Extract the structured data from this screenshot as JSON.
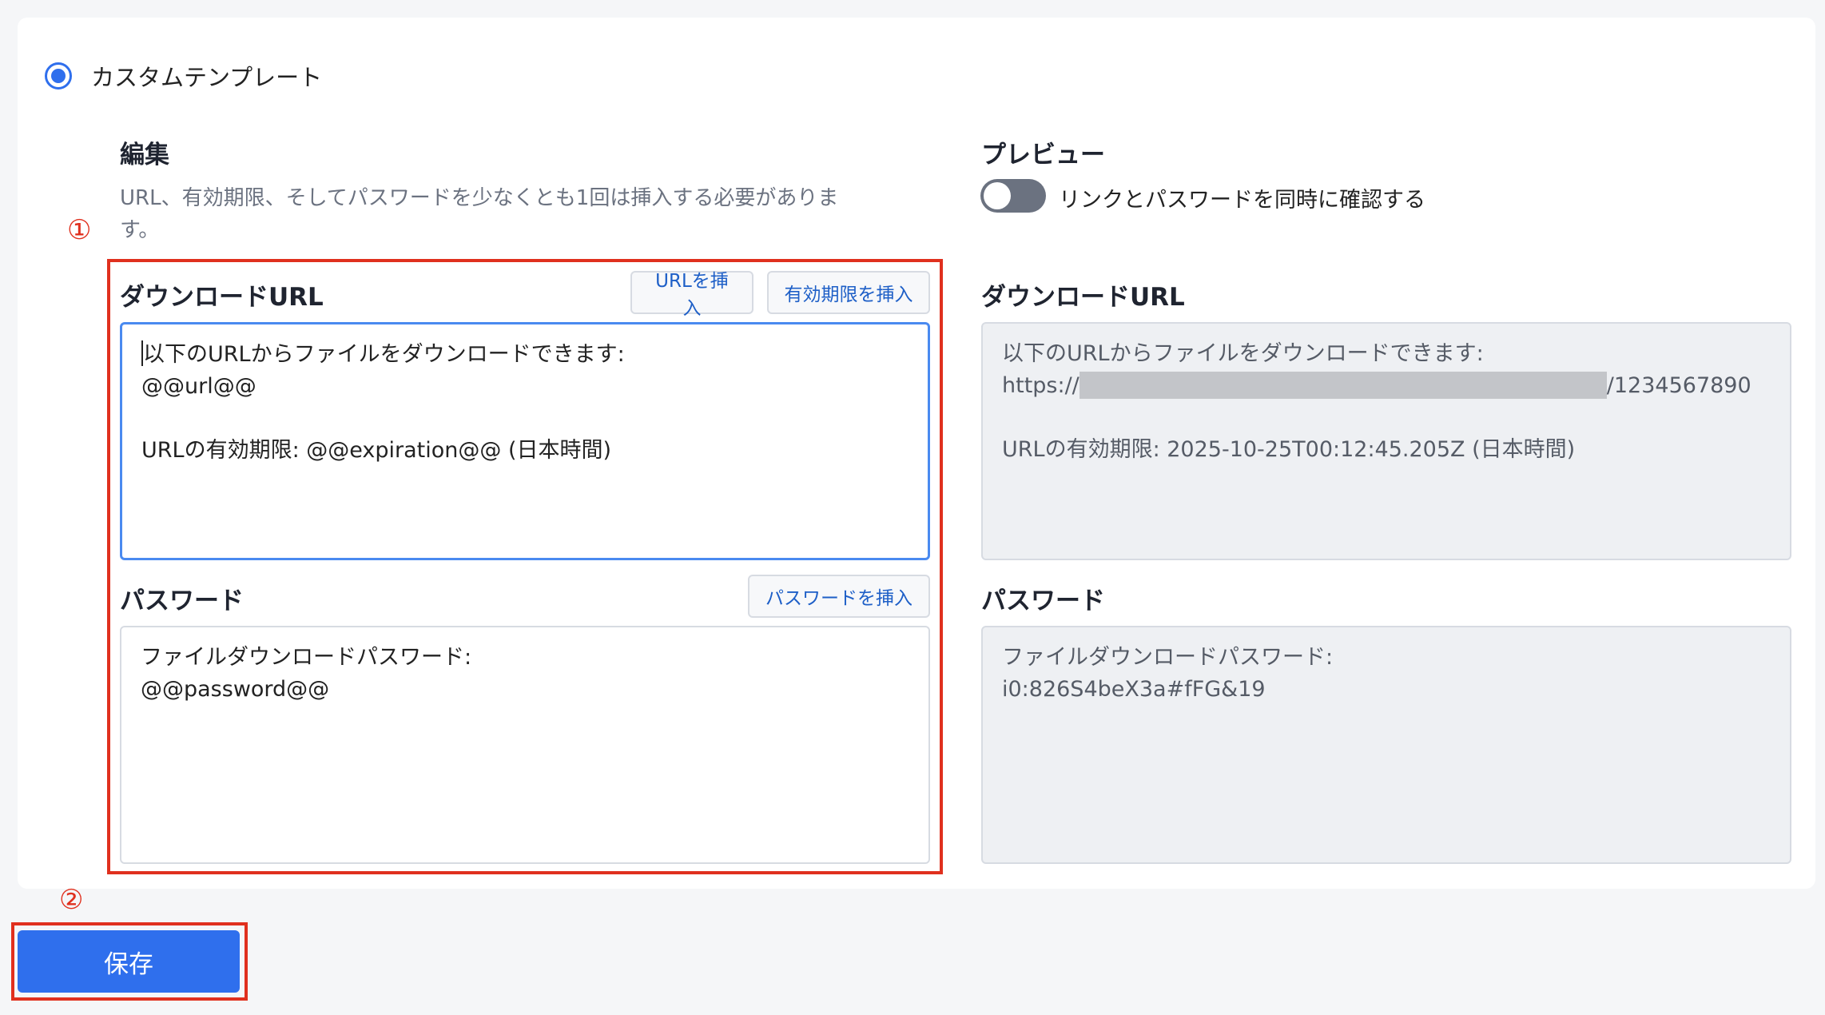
{
  "template_option": {
    "label": "カスタムテンプレート",
    "selected": true
  },
  "edit": {
    "title": "編集",
    "description": "URL、有効期限、そしてパスワードを少なくとも1回は挿入する必要がありま\nす。",
    "download_url": {
      "label": "ダウンロードURL",
      "insert_url_button": "URLを挿入",
      "insert_expiration_button": "有効期限を挿入",
      "lines": [
        "以下のURLからファイルをダウンロードできます:",
        "@@url@@",
        "",
        "URLの有効期限: @@expiration@@ (日本時間)"
      ]
    },
    "password": {
      "label": "パスワード",
      "insert_password_button": "パスワードを挿入",
      "lines": [
        "ファイルダウンロードパスワード:",
        "@@password@@"
      ]
    }
  },
  "preview": {
    "title": "プレビュー",
    "toggle_label": "リンクとパスワードを同時に確認する",
    "toggle_on": false,
    "download_url": {
      "label": "ダウンロードURL",
      "line1": "以下のURLからファイルをダウンロードできます:",
      "url_prefix": "https://",
      "url_suffix": "/1234567890",
      "expiration_line": "URLの有効期限: 2025-10-25T00:12:45.205Z (日本時間)"
    },
    "password": {
      "label": "パスワード",
      "line1": "ファイルダウンロードパスワード:",
      "line2": "i0:826S4beX3a#fFG&19"
    }
  },
  "annotations": {
    "marker1": "①",
    "marker2": "②",
    "color": "#e0301e"
  },
  "save_button": "保存",
  "colors": {
    "accent": "#2f6fed",
    "link": "#1e5fc7"
  }
}
